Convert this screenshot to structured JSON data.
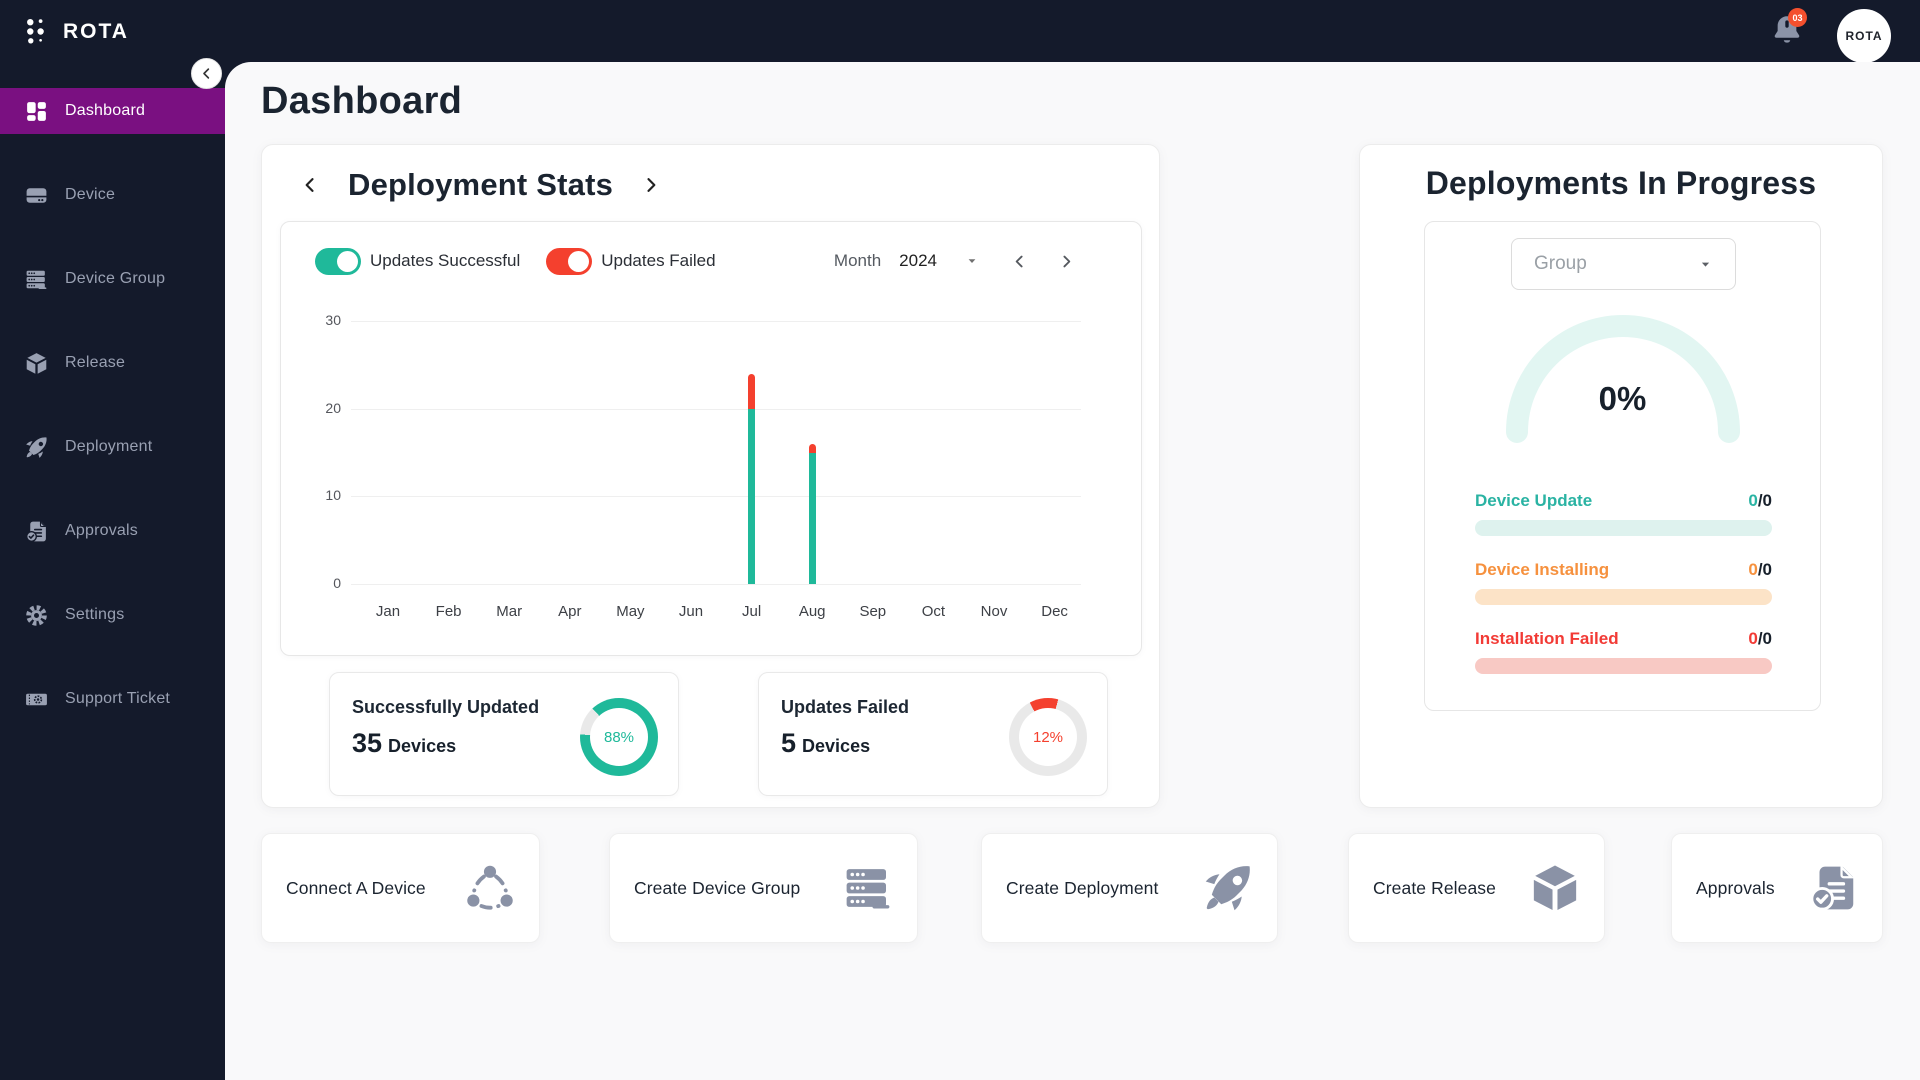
{
  "app": {
    "name": "ROTA",
    "notifications": {
      "count": "03"
    },
    "avatar_text": "ROTA"
  },
  "sidebar": {
    "items": [
      {
        "label": "Dashboard",
        "icon": "dashboard",
        "active": true
      },
      {
        "label": "Device",
        "icon": "device",
        "active": false
      },
      {
        "label": "Device Group",
        "icon": "device-group",
        "active": false
      },
      {
        "label": "Release",
        "icon": "release",
        "active": false
      },
      {
        "label": "Deployment",
        "icon": "rocket",
        "active": false
      },
      {
        "label": "Approvals",
        "icon": "approvals",
        "active": false
      },
      {
        "label": "Settings",
        "icon": "settings",
        "active": false
      },
      {
        "label": "Support Ticket",
        "icon": "ticket",
        "active": false
      }
    ]
  },
  "page": {
    "title": "Dashboard"
  },
  "deployment_stats": {
    "title": "Deployment Stats",
    "toggles": [
      {
        "label": "Updates Successful",
        "on": true,
        "color": "#1fb99a"
      },
      {
        "label": "Updates Failed",
        "on": true,
        "color": "#f4402e"
      }
    ],
    "period": {
      "label": "Month",
      "value": "2024"
    },
    "chart_data": {
      "type": "bar",
      "stacked": true,
      "categories": [
        "Jan",
        "Feb",
        "Mar",
        "Apr",
        "May",
        "Jun",
        "Jul",
        "Aug",
        "Sep",
        "Oct",
        "Nov",
        "Dec"
      ],
      "series": [
        {
          "name": "Updates Successful",
          "color": "#1fb99a",
          "values": [
            0,
            0,
            0,
            0,
            0,
            0,
            20,
            15,
            0,
            0,
            0,
            0
          ]
        },
        {
          "name": "Updates Failed",
          "color": "#f4402e",
          "values": [
            0,
            0,
            0,
            0,
            0,
            0,
            4,
            1,
            0,
            0,
            0,
            0
          ]
        }
      ],
      "ylim": [
        0,
        30
      ],
      "yticks": [
        0,
        10,
        20,
        30
      ],
      "grid": true,
      "legend_position": "top"
    },
    "summary_cards": [
      {
        "title": "Successfully Updated",
        "count": "35",
        "unit": "Devices",
        "percent": 88,
        "percent_label": "88%",
        "color": "#1fb99a",
        "track": "#e9e9e9",
        "donut_from": 317
      },
      {
        "title": "Updates Failed",
        "count": "5",
        "unit": "Devices",
        "percent": 12,
        "percent_label": "12%",
        "color": "#f4402e",
        "track": "#e9e9e9",
        "donut_from": -28
      }
    ]
  },
  "deployments_in_progress": {
    "title": "Deployments In Progress",
    "group_select": {
      "placeholder": "Group"
    },
    "gauge": {
      "value": 0,
      "value_label": "0%",
      "track_color": "#e2f6f2"
    },
    "rows": [
      {
        "label": "Device Update",
        "done": "0",
        "total": "0",
        "color": "#2ab3a3",
        "bar_color": "#def2ee"
      },
      {
        "label": "Device Installing",
        "done": "0",
        "total": "0",
        "color": "#f6913e",
        "bar_color": "#fce3c7"
      },
      {
        "label": "Installation Failed",
        "done": "0",
        "total": "0",
        "color": "#f23a35",
        "bar_color": "#f8c9c4"
      }
    ]
  },
  "quick_actions": [
    {
      "label": "Connect A Device",
      "icon": "network"
    },
    {
      "label": "Create Device Group",
      "icon": "device-group"
    },
    {
      "label": "Create Deployment",
      "icon": "rocket"
    },
    {
      "label": "Create Release",
      "icon": "release"
    },
    {
      "label": "Approvals",
      "icon": "approvals"
    }
  ]
}
